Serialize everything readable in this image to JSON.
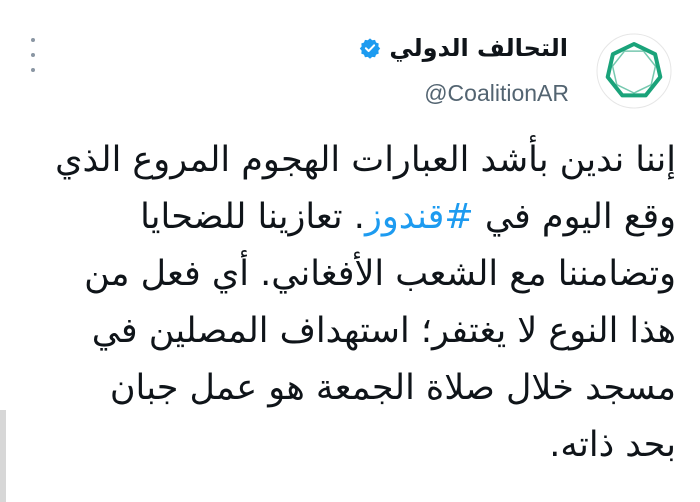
{
  "account": {
    "display_name": "التحالف الدولي",
    "handle": "@CoalitionAR",
    "verified_icon": "verified-badge-icon",
    "avatar_icon": "heptagon-logo-icon",
    "brand_color": "#1aa37a",
    "verified_color": "#1d9bf0"
  },
  "menu": {
    "icon": "more-options-icon"
  },
  "tweet": {
    "lines": [
      "إننا ندين بأشد العبارات الهجوم المروع الذي",
      "وقع اليوم في",
      "مع الشعب الأفغاني. أي فعل من",
      "هذا النوع لا يغتفر؛ استهداف المصلين في",
      "مسجد خلال صلاة الجمعة هو عمل جبان",
      "بحد ذاته."
    ],
    "hashtag": "#قندوز",
    "after_hashtag": ". تعازينا للضحايا",
    "line3_prefix": "وتضامننا",
    "hashtag_color": "#1d9bf0"
  }
}
